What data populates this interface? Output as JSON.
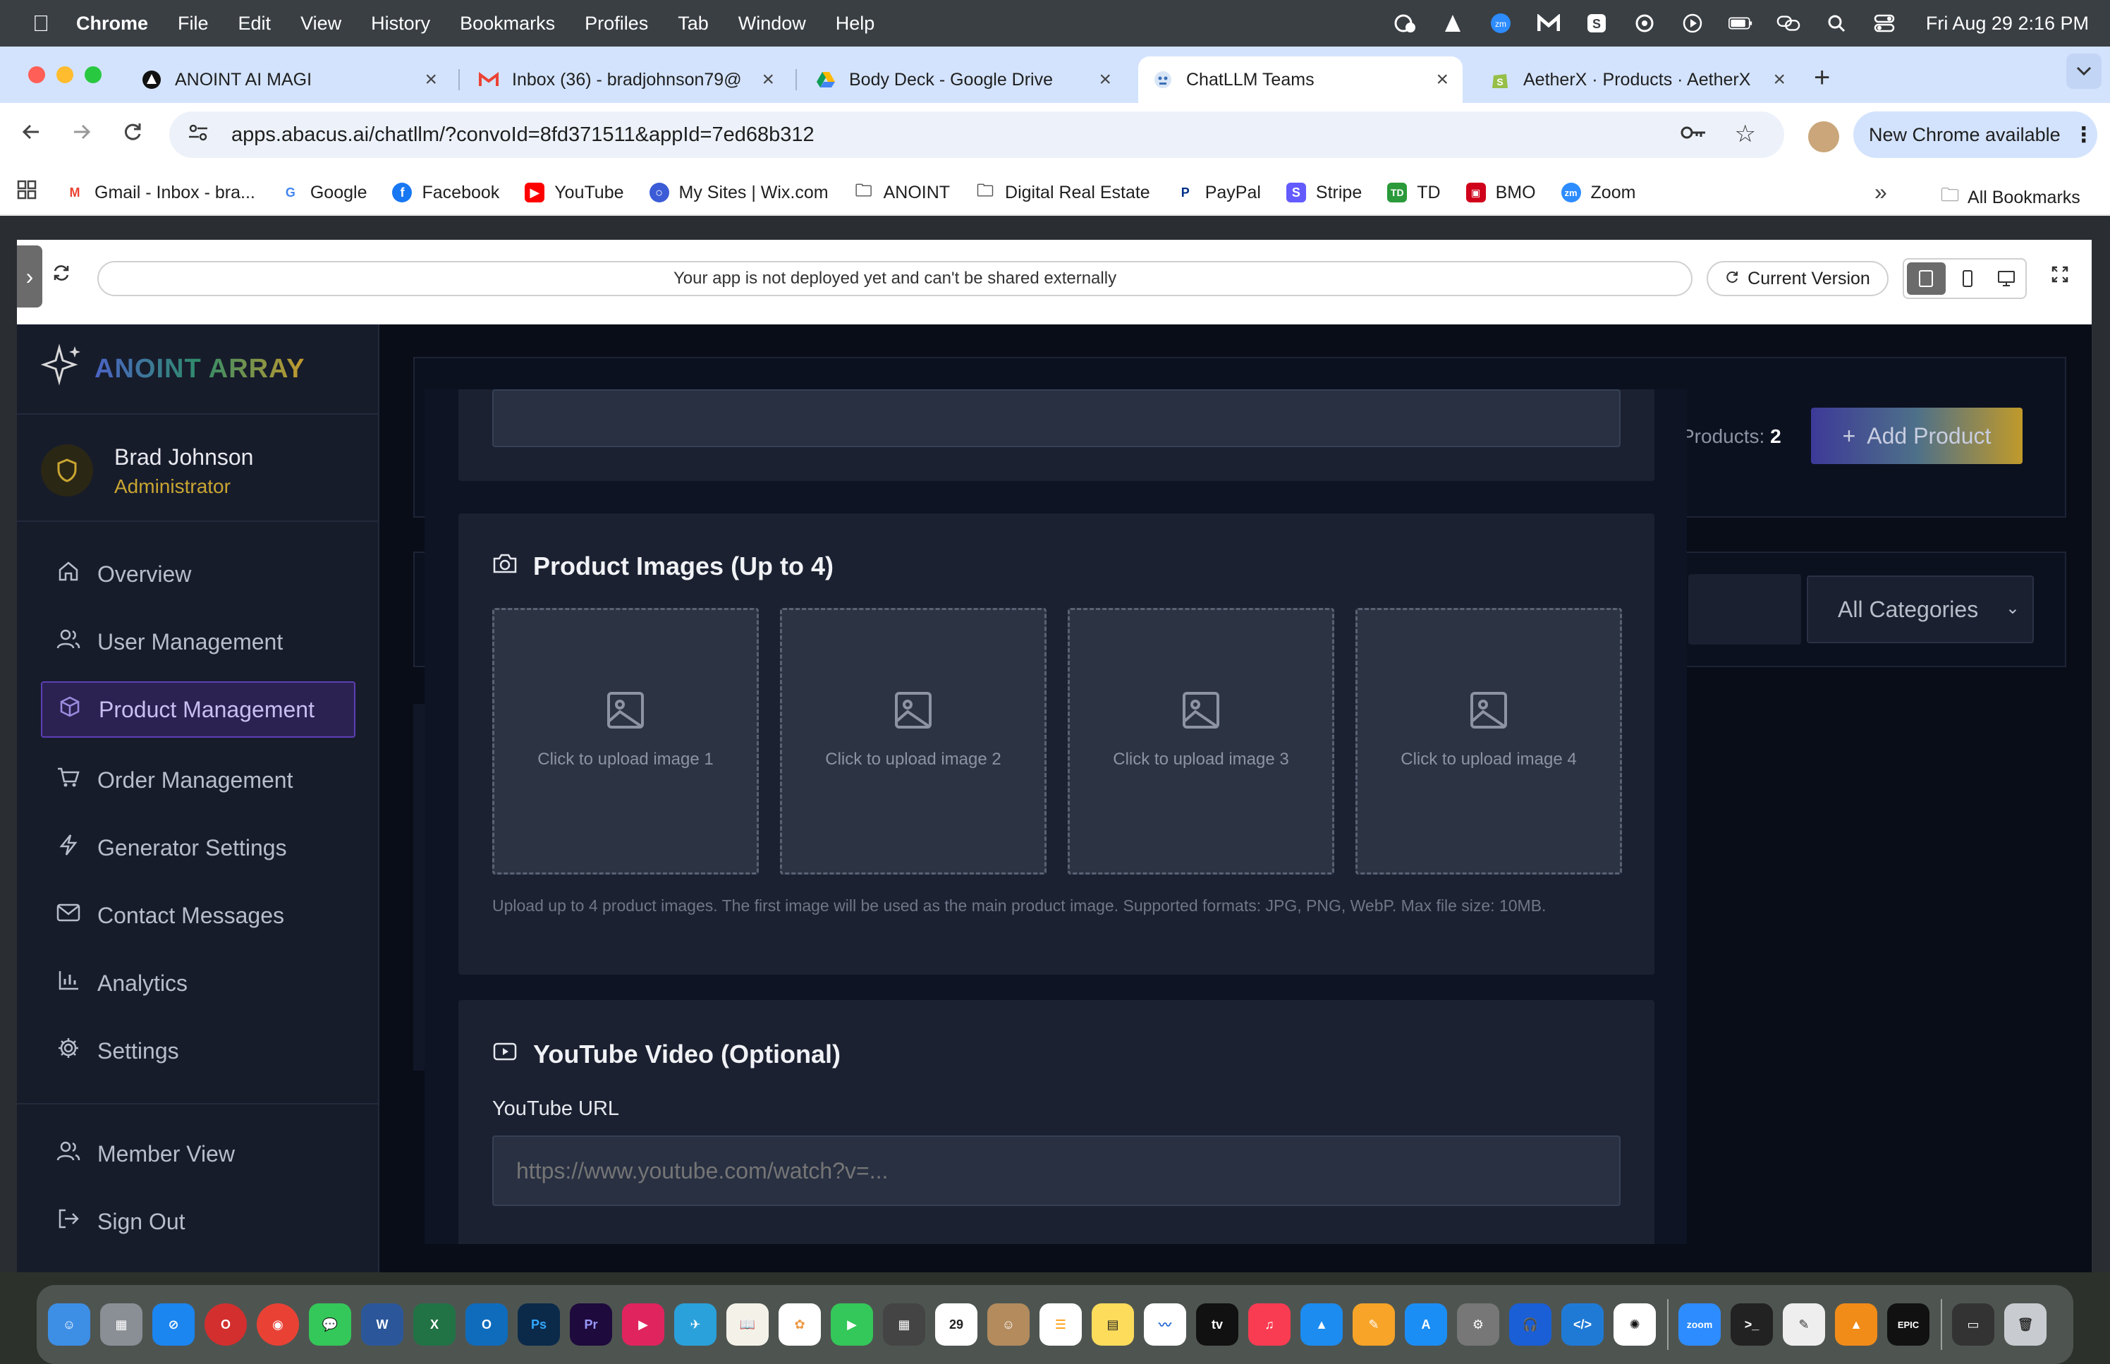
{
  "menubar": {
    "app_name": "Chrome",
    "items": [
      "File",
      "Edit",
      "View",
      "History",
      "Bookmarks",
      "Profiles",
      "Tab",
      "Window",
      "Help"
    ],
    "clock": "Fri Aug 29  2:16 PM"
  },
  "tabs": [
    {
      "title": "ANOINT AI MAGI",
      "icon": "anoint-icon"
    },
    {
      "title": "Inbox (36) - bradjohnson79@",
      "icon": "gmail-icon"
    },
    {
      "title": "Body Deck - Google Drive",
      "icon": "google-drive-icon"
    },
    {
      "title": "ChatLLM Teams",
      "icon": "chatllm-icon"
    },
    {
      "title": "AetherX · Products · AetherX",
      "icon": "shopify-icon"
    }
  ],
  "address_bar": {
    "url": "apps.abacus.ai/chatllm/?convoId=8fd371511&appId=7ed68b312",
    "update_button": "New Chrome available"
  },
  "bookmarks": [
    {
      "label": "Gmail - Inbox - bra...",
      "icon": "gmail-icon",
      "color": "#ea4335"
    },
    {
      "label": "Google",
      "icon": "google-icon",
      "color": "#4285f4"
    },
    {
      "label": "Facebook",
      "icon": "facebook-icon",
      "color": "#1877f2"
    },
    {
      "label": "YouTube",
      "icon": "youtube-icon",
      "color": "#ff0000"
    },
    {
      "label": "My Sites | Wix.com",
      "icon": "wix-icon",
      "color": "#3b5cd6"
    },
    {
      "label": "ANOINT",
      "icon": "folder-icon",
      "color": "#555555"
    },
    {
      "label": "Digital Real Estate",
      "icon": "folder-icon",
      "color": "#555555"
    },
    {
      "label": "PayPal",
      "icon": "paypal-icon",
      "color": "#003087"
    },
    {
      "label": "Stripe",
      "icon": "stripe-icon",
      "color": "#635bff"
    },
    {
      "label": "TD",
      "icon": "td-icon",
      "color": "#2a9a3a"
    },
    {
      "label": "BMO",
      "icon": "bmo-icon",
      "color": "#d0021b"
    },
    {
      "label": "Zoom",
      "icon": "zoom-icon",
      "color": "#2d8cff"
    }
  ],
  "bookmarks_all": "All Bookmarks",
  "preview": {
    "status": "Your app is not deployed yet and can't be shared externally",
    "version_button": "Current Version"
  },
  "app": {
    "brand": "ANOINT ARRAY",
    "user": {
      "name": "Brad Johnson",
      "role": "Administrator"
    },
    "nav": [
      {
        "label": "Overview",
        "icon": "home-icon"
      },
      {
        "label": "User Management",
        "icon": "users-icon"
      },
      {
        "label": "Product Management",
        "icon": "package-icon"
      },
      {
        "label": "Order Management",
        "icon": "cart-icon"
      },
      {
        "label": "Generator Settings",
        "icon": "lightning-icon"
      },
      {
        "label": "Contact Messages",
        "icon": "mail-icon"
      },
      {
        "label": "Analytics",
        "icon": "bar-chart-icon"
      },
      {
        "label": "Settings",
        "icon": "gear-icon"
      }
    ],
    "bottom_nav": [
      {
        "label": "Member View",
        "icon": "users-icon"
      },
      {
        "label": "Sign Out",
        "icon": "sign-out-icon"
      }
    ],
    "background": {
      "products_label": "Products:",
      "products_count": "2",
      "add_product": "Add Product",
      "category_select": "All Categories"
    },
    "modal": {
      "images_title": "Product Images (Up to 4)",
      "upload_slots": [
        "Click to upload image 1",
        "Click to upload image 2",
        "Click to upload image 3",
        "Click to upload image 4"
      ],
      "images_hint": "Upload up to 4 product images. The first image will be used as the main product image. Supported formats: JPG, PNG, WebP. Max file size: 10MB.",
      "video_title": "YouTube Video (Optional)",
      "youtube_label": "YouTube URL",
      "youtube_placeholder": "https://www.youtube.com/watch?v=..."
    }
  }
}
